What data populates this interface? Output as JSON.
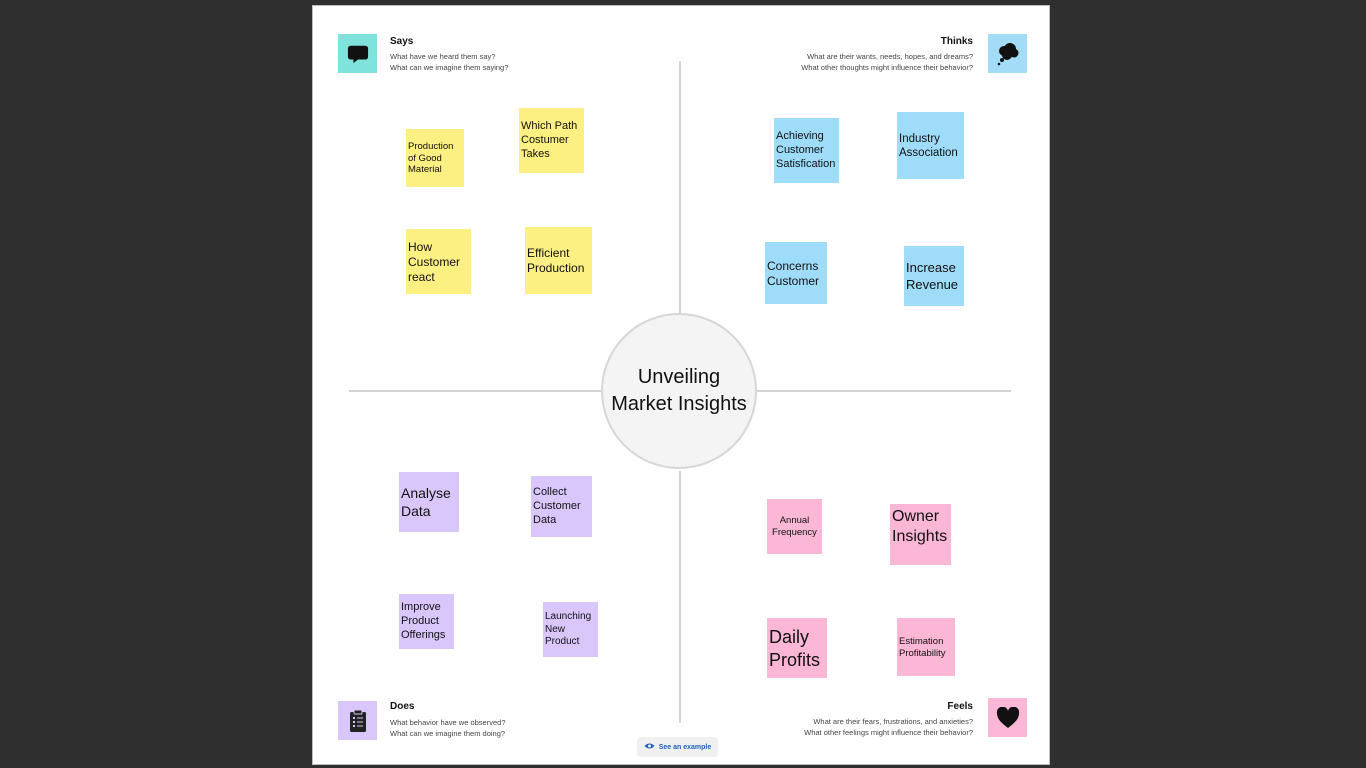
{
  "center": {
    "title": "Unveiling Market Insights"
  },
  "quadrants": {
    "says": {
      "title": "Says",
      "question1": "What have we heard them say?",
      "question2": "What can we imagine them saying?",
      "color": "#7fe3db",
      "icon": "speech-bubble-icon",
      "notes": [
        "Production of Good Material",
        "Which Path Costumer Takes",
        "How Customer react",
        "Efficient Production"
      ]
    },
    "thinks": {
      "title": "Thinks",
      "question1": "What are their wants, needs, hopes, and dreams?",
      "question2": "What other thoughts might influence their behavior?",
      "color": "#a2dcf7",
      "icon": "thought-bubble-icon",
      "notes": [
        "Achieving Customer Satisfication",
        "Industry Association",
        "Concerns Customer",
        "Increase Revenue"
      ]
    },
    "does": {
      "title": "Does",
      "question1": "What behavior have we observed?",
      "question2": "What can we imagine them doing?",
      "color": "#d9c7fb",
      "icon": "clipboard-icon",
      "notes": [
        "Analyse Data",
        "Collect Customer Data",
        "Improve Product Offerings",
        "Launching New Product"
      ]
    },
    "feels": {
      "title": "Feels",
      "question1": "What are their fears, frustrations, and anxieties?",
      "question2": "What other feelings might influence their behavior?",
      "color": "#fbb7d5",
      "icon": "heart-icon",
      "notes": [
        "Annual Frequency",
        "Owner Insights",
        "Daily Profits",
        "Estimation Profitability"
      ]
    }
  },
  "footer": {
    "see_example": "See an example"
  }
}
